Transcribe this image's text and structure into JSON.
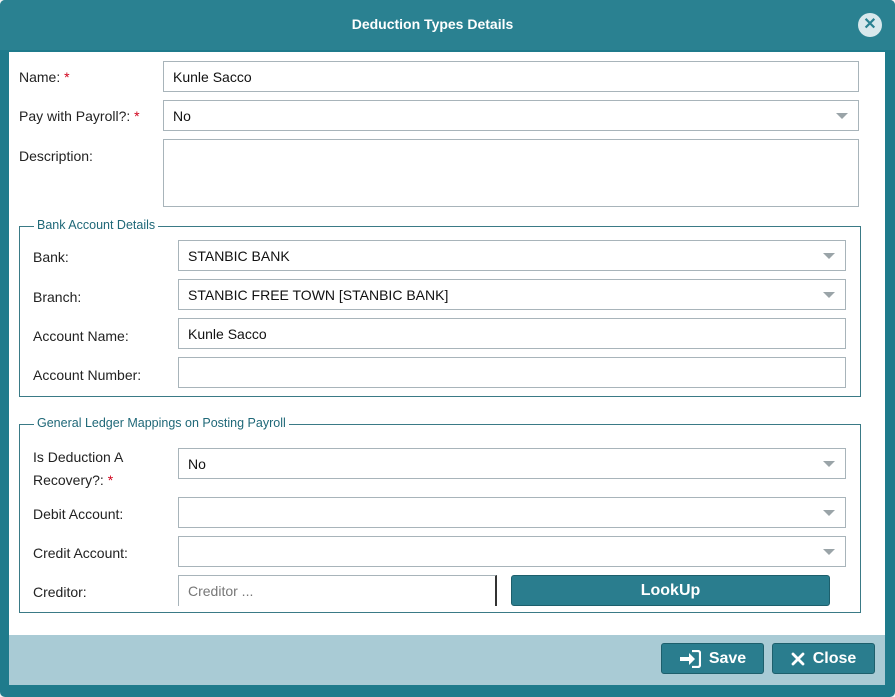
{
  "dialog": {
    "title": "Deduction Types Details",
    "close_glyph": "✕"
  },
  "form": {
    "name": {
      "label": "Name:",
      "required_mark": "*",
      "value": "Kunle Sacco"
    },
    "pay_with_payroll": {
      "label": "Pay with Payroll?:",
      "required_mark": "*",
      "value": "No"
    },
    "description": {
      "label": "Description:",
      "value": ""
    }
  },
  "bank_account_details": {
    "legend": "Bank Account Details",
    "bank": {
      "label": "Bank:",
      "value": "STANBIC BANK"
    },
    "branch": {
      "label": "Branch:",
      "value": "STANBIC FREE TOWN [STANBIC BANK]"
    },
    "account_name": {
      "label": "Account Name:",
      "value": "Kunle Sacco"
    },
    "account_number": {
      "label": "Account Number:",
      "value": ""
    }
  },
  "gl_mappings": {
    "legend": "General Ledger Mappings on Posting Payroll",
    "is_recovery": {
      "label_line1": "Is Deduction A",
      "label_line2": "Recovery?:",
      "required_mark": "*",
      "value": "No"
    },
    "debit_account": {
      "label": "Debit Account:",
      "value": ""
    },
    "credit_account": {
      "label": "Credit Account:",
      "value": ""
    },
    "creditor": {
      "label": "Creditor:",
      "placeholder": "Creditor ...",
      "value": ""
    },
    "lookup_label": "LookUp"
  },
  "footer": {
    "save_label": "Save",
    "close_label": "Close"
  },
  "icons": {
    "dropdown": "chevron-down-icon",
    "save": "sign-in-icon",
    "close": "close-icon"
  },
  "colors": {
    "header": "#2a8191",
    "footer": "#a9cbd5",
    "button": "#2a7d8e",
    "required": "#d0021b"
  }
}
